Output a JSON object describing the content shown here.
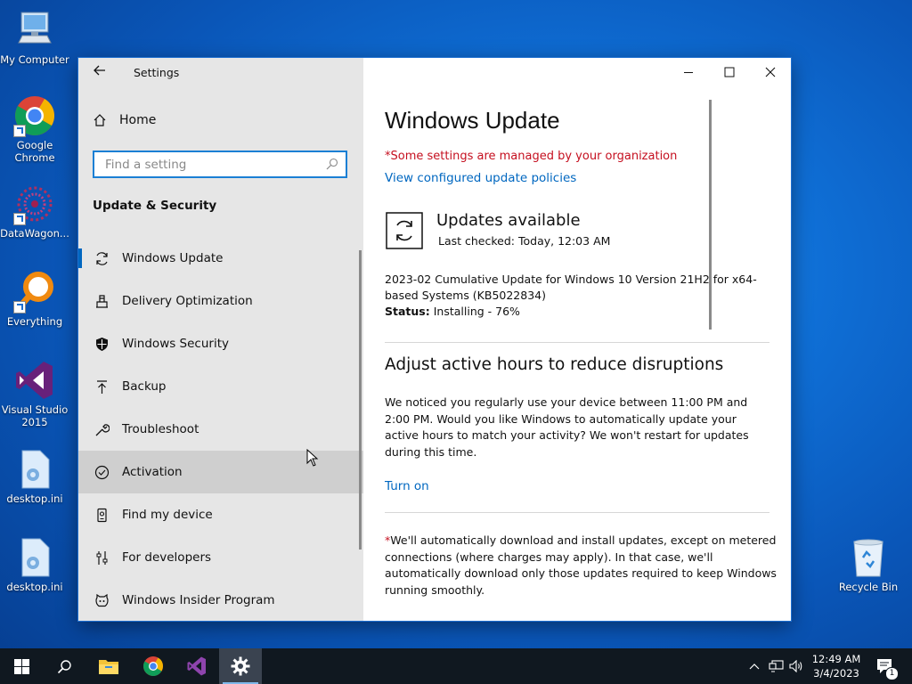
{
  "desktop": {
    "icons": [
      {
        "label": "My Computer"
      },
      {
        "label": "Google Chrome"
      },
      {
        "label": "DataWagon..."
      },
      {
        "label": "Everything"
      },
      {
        "label": "Visual Studio 2015"
      },
      {
        "label": "desktop.ini"
      },
      {
        "label": "desktop.ini"
      },
      {
        "label": "Recycle Bin"
      }
    ]
  },
  "window": {
    "app_title": "Settings",
    "controls": {
      "minimize": "minimize-icon",
      "maximize": "maximize-icon",
      "close": "close-icon"
    }
  },
  "sidebar": {
    "home_label": "Home",
    "search_placeholder": "Find a setting",
    "section_title": "Update & Security",
    "items": [
      {
        "label": "Windows Update",
        "icon": "sync-icon"
      },
      {
        "label": "Delivery Optimization",
        "icon": "delivery-icon"
      },
      {
        "label": "Windows Security",
        "icon": "shield-icon"
      },
      {
        "label": "Backup",
        "icon": "backup-icon"
      },
      {
        "label": "Troubleshoot",
        "icon": "wrench-icon"
      },
      {
        "label": "Activation",
        "icon": "check-circle-icon"
      },
      {
        "label": "Find my device",
        "icon": "find-device-icon"
      },
      {
        "label": "For developers",
        "icon": "developer-icon"
      },
      {
        "label": "Windows Insider Program",
        "icon": "insider-icon"
      }
    ]
  },
  "main": {
    "title": "Windows Update",
    "managed_notice": "*Some settings are managed by your organization",
    "policies_link": "View configured update policies",
    "updates_title": "Updates available",
    "last_checked": "Last checked: Today, 12:03 AM",
    "update_name": "2023-02 Cumulative Update for Windows 10 Version 21H2 for x64-based Systems (KB5022834)",
    "status_label": "Status:",
    "status_value": "Installing - 76%",
    "progress_percent": 76,
    "active_hours_title": "Adjust active hours to reduce disruptions",
    "active_hours_text": "We noticed you regularly use your device between 11:00 PM and 2:00 PM. Would you like Windows to automatically update your active hours to match your activity? We won't restart for updates during this time.",
    "turn_on_link": "Turn on",
    "note_star": "*",
    "note_text": "We'll automatically download and install updates, except on metered connections (where charges may apply). In that case, we'll automatically download only those updates required to keep Windows running smoothly."
  },
  "taskbar": {
    "time": "12:49 AM",
    "date": "3/4/2023",
    "notification_count": "1"
  },
  "colors": {
    "accent": "#0067c0",
    "warning": "#c50f1f",
    "taskbar": "#101820"
  }
}
